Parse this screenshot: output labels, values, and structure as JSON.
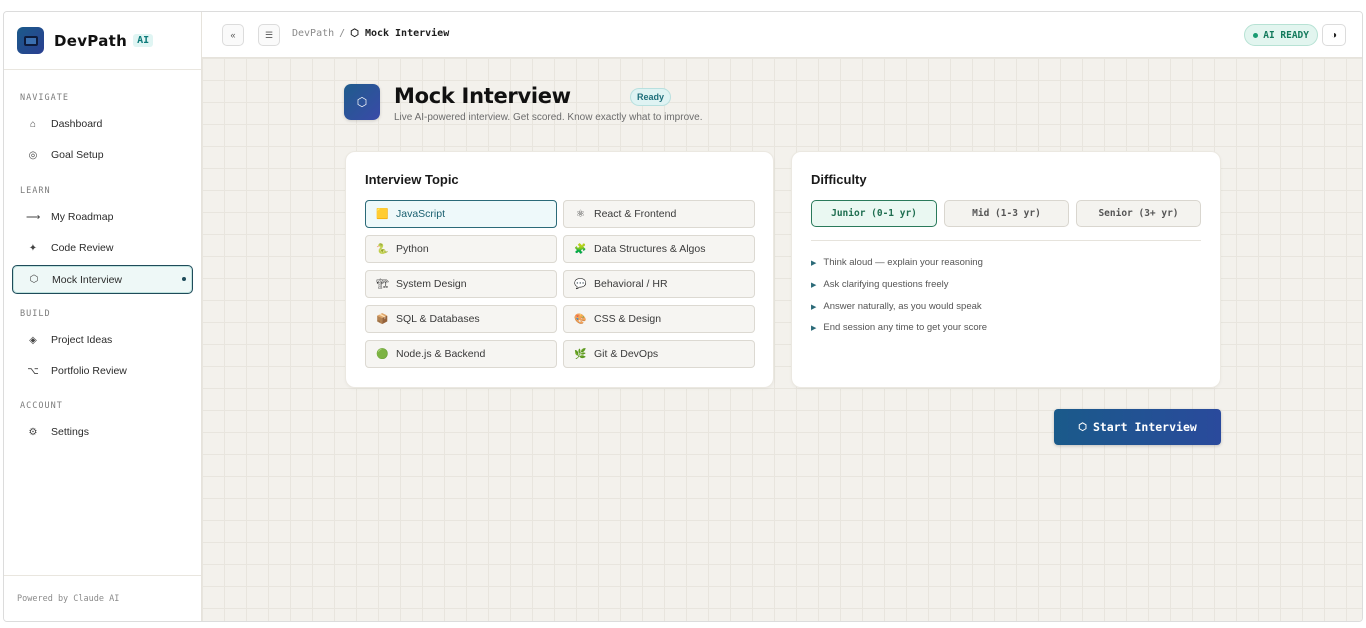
{
  "brand": {
    "name": "DevPath",
    "badge": "AI"
  },
  "sidebar": {
    "sections": [
      {
        "title": "NAVIGATE",
        "items": [
          {
            "label": "Dashboard",
            "icon": "⌂"
          },
          {
            "label": "Goal Setup",
            "icon": "◎"
          }
        ]
      },
      {
        "title": "LEARN",
        "items": [
          {
            "label": "My Roadmap",
            "icon": "⟶"
          },
          {
            "label": "Code Review",
            "icon": "✦"
          },
          {
            "label": "Mock Interview",
            "icon": "⬡"
          }
        ]
      },
      {
        "title": "BUILD",
        "items": [
          {
            "label": "Project Ideas",
            "icon": "◈"
          },
          {
            "label": "Portfolio Review",
            "icon": "⌥"
          }
        ]
      },
      {
        "title": "ACCOUNT",
        "items": [
          {
            "label": "Settings",
            "icon": "⚙"
          }
        ]
      }
    ],
    "footer": "Powered by Claude AI"
  },
  "topbar": {
    "collapse_icon": "«",
    "menu_icon": "☰",
    "breadcrumb_root": "DevPath",
    "breadcrumb_sep": "/",
    "breadcrumb_current": "⬡ Mock Interview",
    "status": "AI READY",
    "theme_icon": "◑"
  },
  "page": {
    "icon": "⬡",
    "title": "Mock Interview",
    "badge": "Ready",
    "subtitle": "Live AI-powered interview. Get scored. Know exactly what to improve."
  },
  "topics": {
    "title": "Interview Topic",
    "items": [
      {
        "label": "JavaScript",
        "icon": "🟨"
      },
      {
        "label": "React & Frontend",
        "icon": "⚛"
      },
      {
        "label": "Python",
        "icon": "🐍"
      },
      {
        "label": "Data Structures & Algos",
        "icon": "🧩"
      },
      {
        "label": "System Design",
        "icon": "🏗"
      },
      {
        "label": "Behavioral / HR",
        "icon": "💬"
      },
      {
        "label": "SQL & Databases",
        "icon": "📦"
      },
      {
        "label": "CSS & Design",
        "icon": "🎨"
      },
      {
        "label": "Node.js & Backend",
        "icon": "🟢"
      },
      {
        "label": "Git & DevOps",
        "icon": "🌿"
      }
    ]
  },
  "difficulty": {
    "title": "Difficulty",
    "options": [
      "Junior (0-1 yr)",
      "Mid (1-3 yr)",
      "Senior (3+ yr)"
    ],
    "tips": [
      "Think aloud — explain your reasoning",
      "Ask clarifying questions freely",
      "Answer naturally, as you would speak",
      "End session any time to get your score"
    ]
  },
  "start_button": {
    "icon": "⬡",
    "label": "Start Interview"
  }
}
